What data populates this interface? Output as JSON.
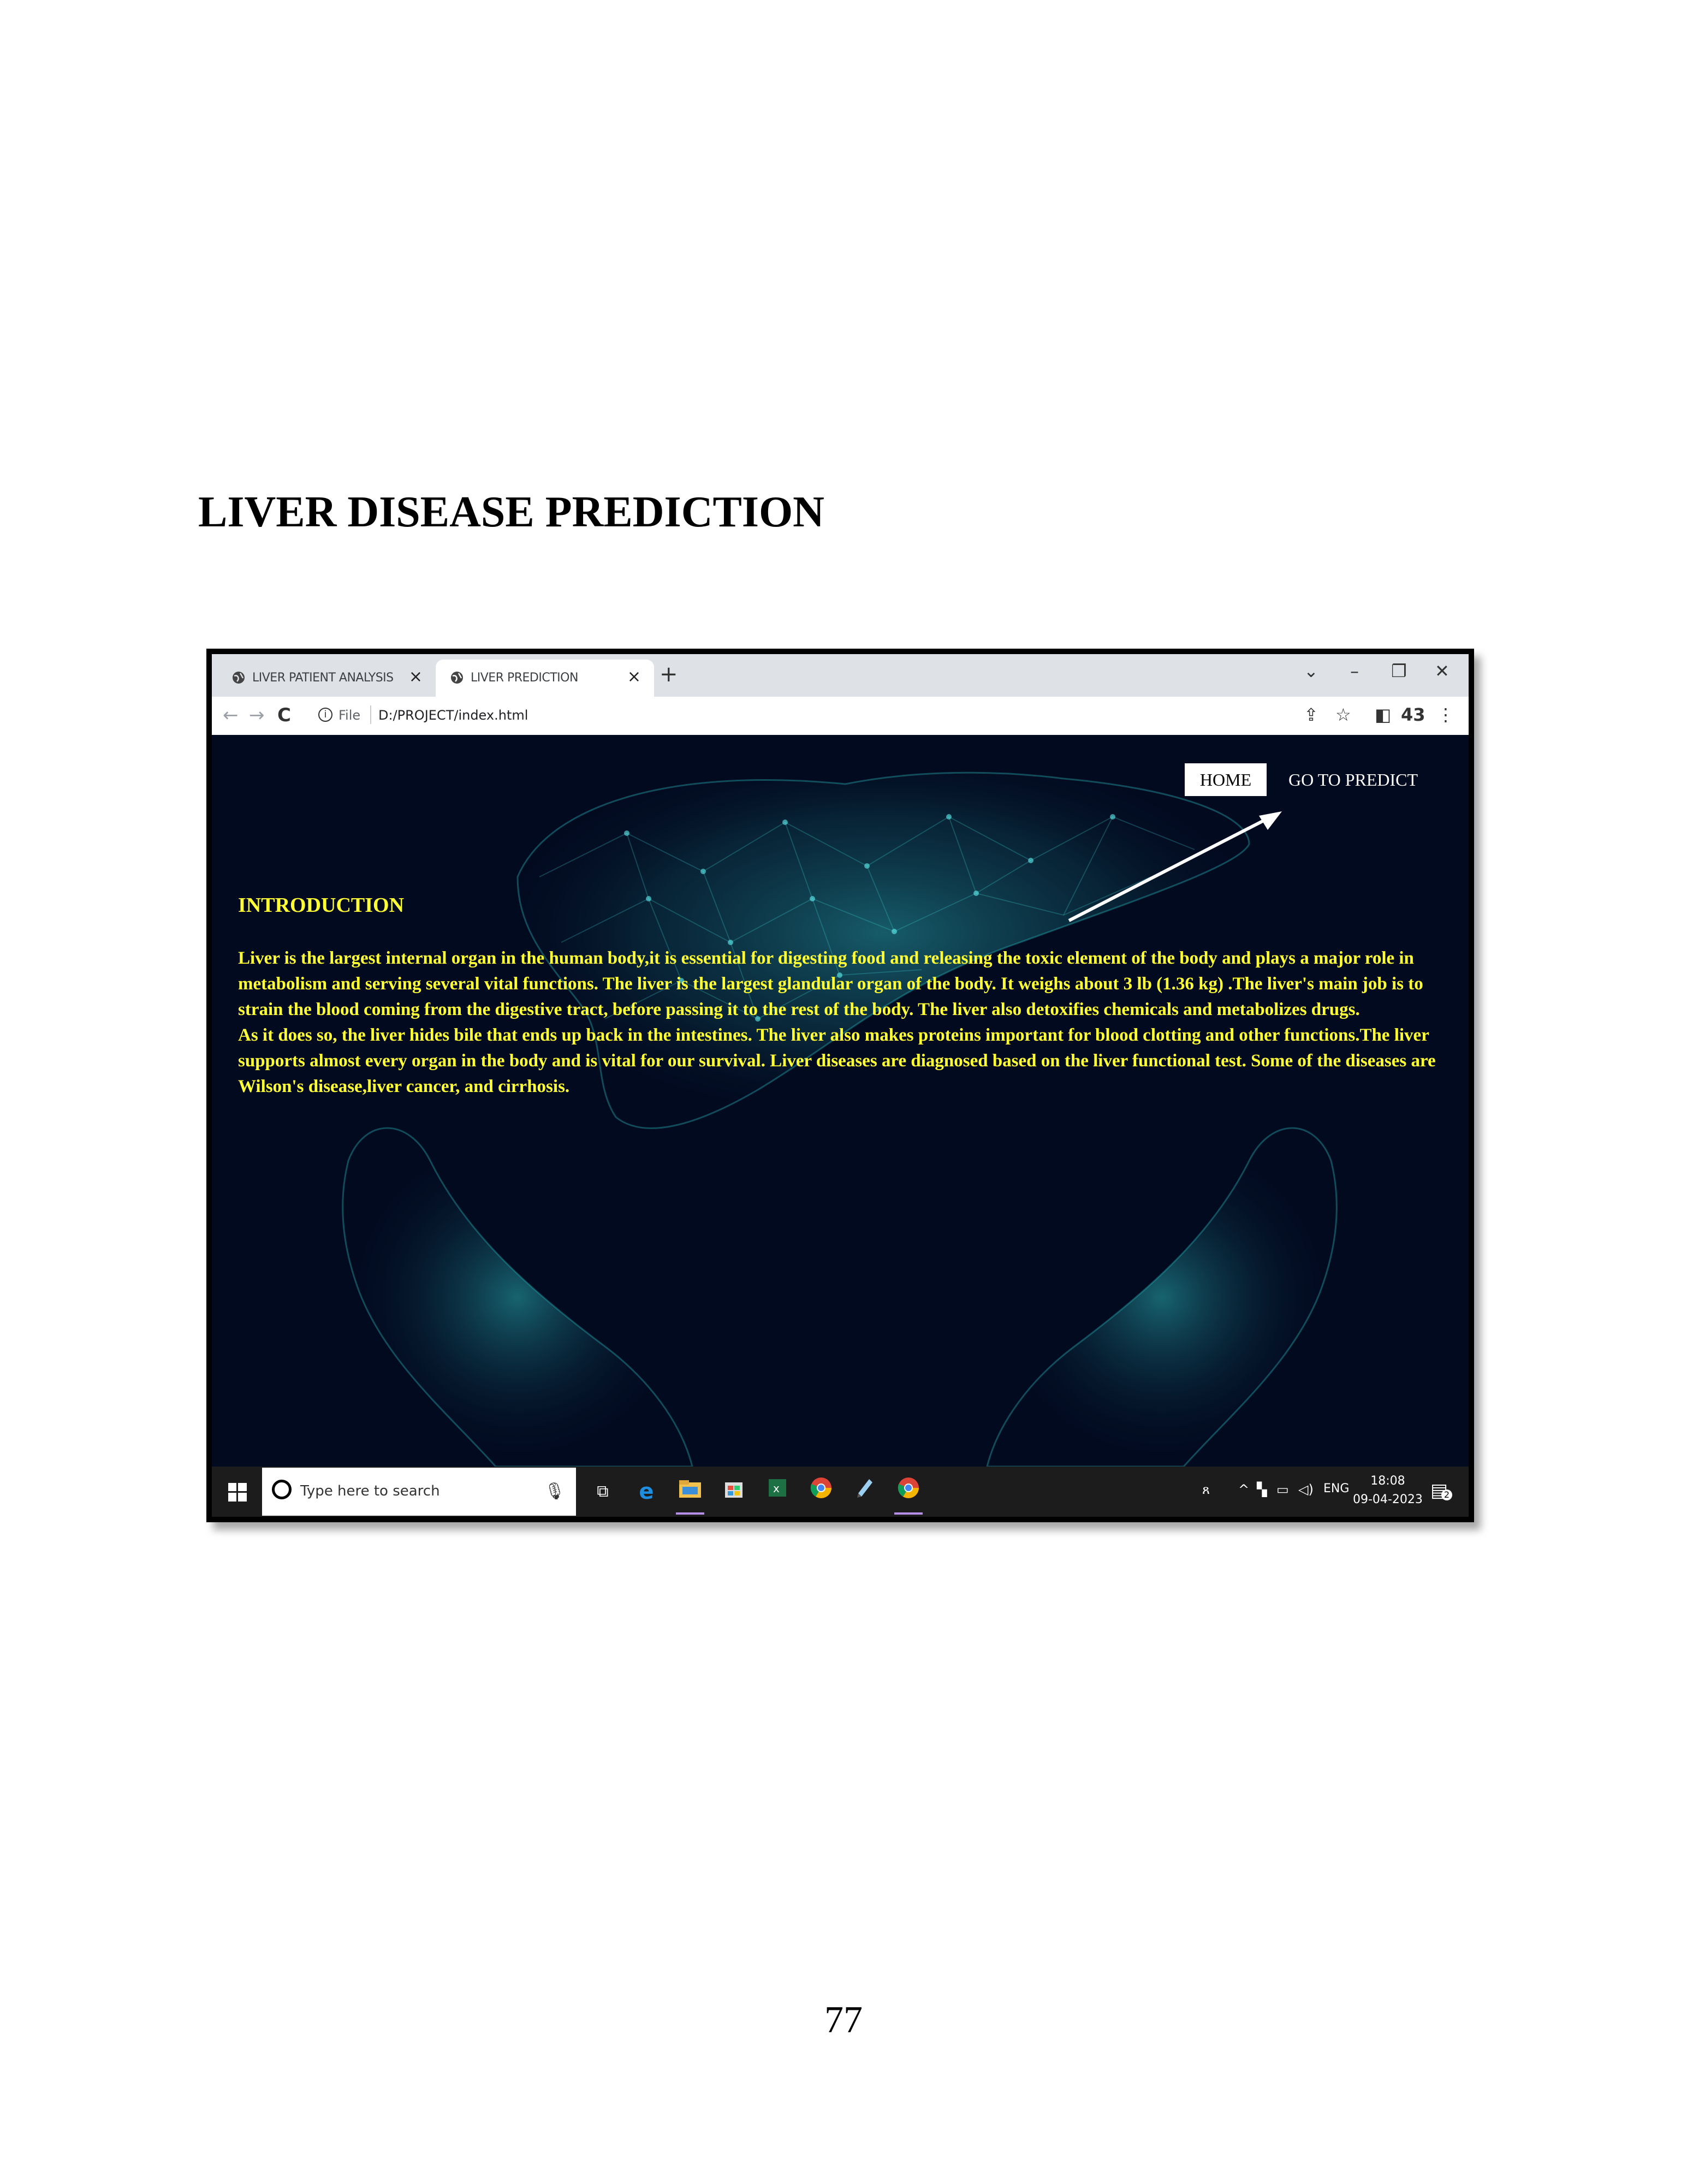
{
  "document": {
    "heading": "LIVER DISEASE PREDICTION",
    "page_number": "77"
  },
  "browser": {
    "tabs": [
      {
        "label": "LIVER PATIENT ANALYSIS",
        "active": false
      },
      {
        "label": "LIVER PREDICTION",
        "active": true
      }
    ],
    "tab_close": "×",
    "new_tab": "+",
    "window_controls": {
      "dropdown": "⌄",
      "minimize": "–",
      "restore": "❐",
      "close": "✕"
    },
    "nav": {
      "back": "←",
      "forward": "→",
      "reload": "C"
    },
    "address": {
      "info": "i",
      "scheme": "File",
      "url": "D:/PROJECT/index.html"
    },
    "toolbar": {
      "share": "⇪",
      "star": "☆",
      "sidebar": "◧",
      "extension_badge": "43",
      "menu": "⋮"
    }
  },
  "site": {
    "nav": {
      "home": "HOME",
      "predict": "GO TO PREDICT"
    },
    "intro_heading": "INTRODUCTION",
    "intro_paragraphs": [
      "Liver is the largest internal organ in the human body,it is essential for digesting food and releasing the toxic element of the body and plays a major role in metabolism and serving several vital functions. The liver is the largest glandular organ of the body. It weighs about 3 lb (1.36 kg) .The liver's main job is to strain the blood coming from the digestive tract, before passing it to the rest of the body. The liver also detoxifies chemicals and metabolizes drugs.",
      "As it does so, the liver hides bile that ends up back in the intestines. The liver also makes proteins important for blood clotting and other functions.The liver supports almost every organ in the body and is vital for our survival. Liver diseases are diagnosed based on the liver functional test. Some of the diseases are Wilson's disease,liver cancer, and cirrhosis."
    ],
    "colors": {
      "background": "#020a20",
      "accent_text": "#ffff33",
      "glow": "#1fb5b5"
    }
  },
  "taskbar": {
    "search_placeholder": "Type here to search",
    "mic_icon": "microphone-icon",
    "apps": [
      "task-view-icon",
      "edge-icon",
      "file-explorer-icon",
      "store-icon",
      "excel-icon",
      "chrome-icon",
      "notepad-icon",
      "chrome-active-icon"
    ],
    "tray_lang": "ENG",
    "time": "18:08",
    "date": "09-04-2023",
    "notification_count": "2"
  }
}
